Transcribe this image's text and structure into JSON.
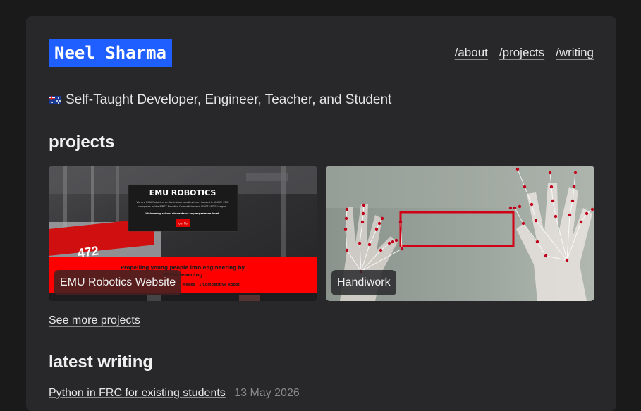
{
  "header": {
    "logo": "Neel Sharma",
    "nav": [
      "/about",
      "/projects",
      "/writing"
    ]
  },
  "tagline": "Self-Taught Developer, Engineer, Teacher, and Student",
  "projects": {
    "title": "projects",
    "items": [
      {
        "label": "EMU Robotics Website",
        "screenshot": {
          "heading": "EMU ROBOTICS",
          "blurb1": "We are EMU Robotics, an Australian robotics team housed in UNSW. EMU",
          "blurb2": "competes in the FIRST Robotics Competition and FIRST LEGO League.",
          "blurb3": "Welcoming school students of any experience level.",
          "button": "Join Us",
          "banner1": "Propelling young people into engineering by",
          "banner2": "STEM learning",
          "banner3": "Weeks · 1 Competitive Robot",
          "bumper": "472"
        }
      },
      {
        "label": "Handiwork"
      }
    ],
    "see_more": "See more projects"
  },
  "writing": {
    "title": "latest writing",
    "items": [
      {
        "title": "Python in FRC for existing students",
        "date": "13 May 2026"
      }
    ]
  },
  "colors": {
    "background": "#1a1a1b",
    "card": "#28282a",
    "accent": "#1f5eff",
    "emu_red": "#ff0000",
    "landmark": "#c0001a"
  },
  "icons": [
    "australia-flag-icon"
  ]
}
